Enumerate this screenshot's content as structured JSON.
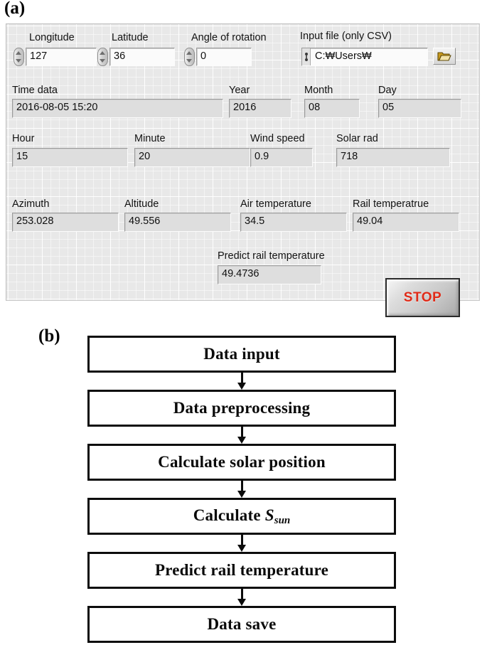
{
  "figure": {
    "panel_a_label": "(a)",
    "panel_b_label": "(b)"
  },
  "front_panel": {
    "controls": [
      {
        "label": "Longitude",
        "value": "127",
        "kind": "numeric-control",
        "has_spinner": true
      },
      {
        "label": "Latitude",
        "value": "36",
        "kind": "numeric-control",
        "has_spinner": true
      },
      {
        "label": "Angle of rotation",
        "value": "0",
        "kind": "numeric-control",
        "has_spinner": true
      },
      {
        "label": "Input file (only CSV)",
        "value": "C:₩Users₩",
        "kind": "path-control",
        "has_spinner": false
      }
    ],
    "indicators": [
      {
        "label": "Time data",
        "value": "2016-08-05 15:20"
      },
      {
        "label": "Year",
        "value": "2016"
      },
      {
        "label": "Month",
        "value": "08"
      },
      {
        "label": "Day",
        "value": "05"
      },
      {
        "label": "Hour",
        "value": "15"
      },
      {
        "label": "Minute",
        "value": "20"
      },
      {
        "label": "Wind speed",
        "value": "0.9"
      },
      {
        "label": "Solar rad",
        "value": "718"
      },
      {
        "label": "Azimuth",
        "value": "253.028"
      },
      {
        "label": "Altitude",
        "value": "49.556"
      },
      {
        "label": "Air temperature",
        "value": "34.5"
      },
      {
        "label": "Rail temperatrue",
        "value": "49.04"
      },
      {
        "label": "Predict rail temperature",
        "value": "49.4736"
      }
    ],
    "browse_button": {
      "icon": "folder-open-icon"
    },
    "stop_button": {
      "label": "STOP",
      "color": "#e02b18"
    }
  },
  "flowchart": {
    "steps": [
      {
        "label": "Data input"
      },
      {
        "label": "Data preprocessing"
      },
      {
        "label": "Calculate solar position"
      },
      {
        "label": "Calculate S",
        "symbol": "S",
        "subscript": "sun",
        "prefix": "Calculate "
      },
      {
        "label": "Predict rail temperature"
      },
      {
        "label": "Data save"
      }
    ]
  }
}
